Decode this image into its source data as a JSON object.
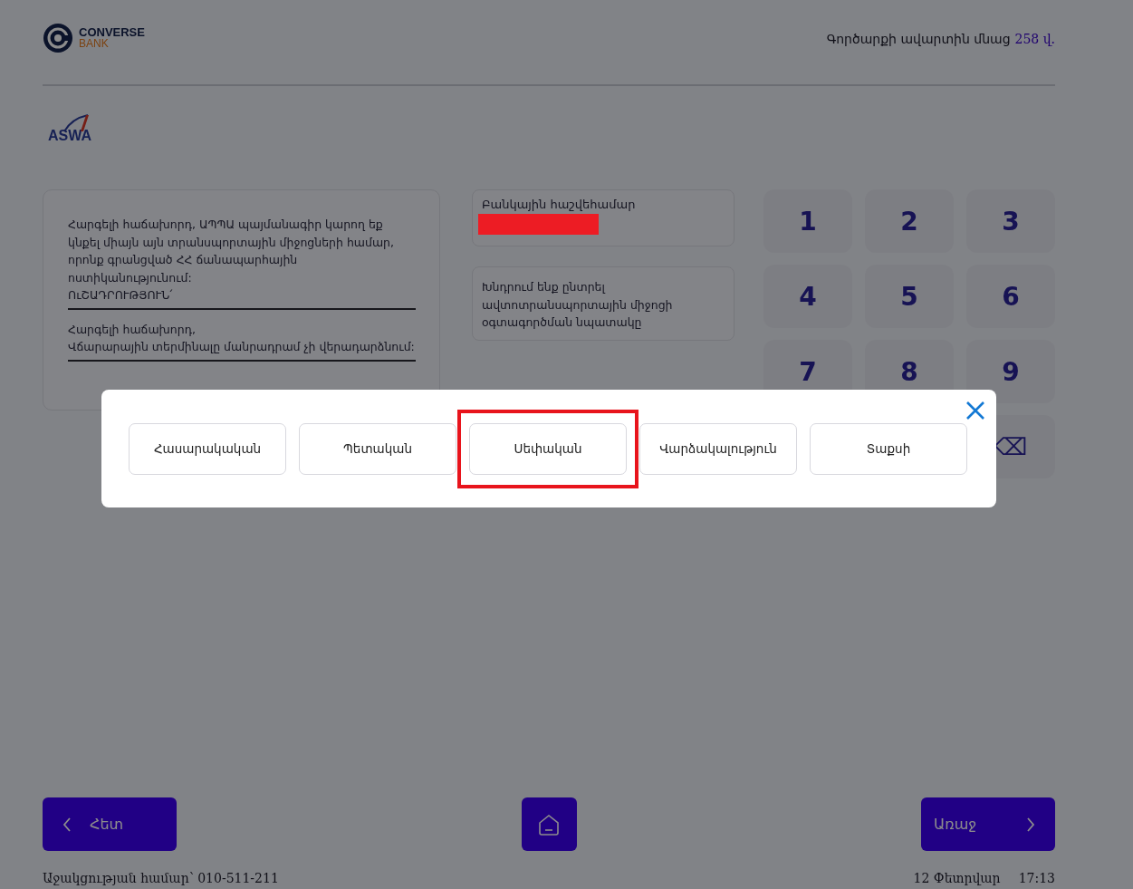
{
  "header": {
    "logo": {
      "name": "CONVERSE",
      "sub": "BANK"
    },
    "timer": {
      "label": "Գործարքի ավարտին մնաց",
      "value": "258 վ."
    }
  },
  "partner_logo": {
    "text": "ASWA"
  },
  "notice": {
    "paragraphs": [
      {
        "lines": [
          "Հարգելի հաճախորդ, ԱՊՊԱ պայմանագիր կարող եք կնքել միայն այն տրանսպորտային միջոցների համար, որոնք գրանցված ՀՀ ճանապարհային ոստիկանությունում:",
          "ՈւՇԱԴՐՈՒԹՅՈՒՆ՛"
        ]
      },
      {
        "lines": [
          "Հարգելի հաճախորդ,",
          "Վճարարային տերմինալը մանրադրամ չի վերադարձնում:"
        ]
      }
    ]
  },
  "account": {
    "label": "Բանկային հաշվեհամար",
    "redacted": true
  },
  "prompt": "Խնդրում ենք ընտրել ավտոտրանսպորտային միջոցի օգտագործման նպատակը",
  "keypad": [
    {
      "kind": "digit",
      "label": "1"
    },
    {
      "kind": "digit",
      "label": "2"
    },
    {
      "kind": "digit",
      "label": "3"
    },
    {
      "kind": "digit",
      "label": "4"
    },
    {
      "kind": "digit",
      "label": "5"
    },
    {
      "kind": "digit",
      "label": "6"
    },
    {
      "kind": "digit",
      "label": "7"
    },
    {
      "kind": "digit",
      "label": "8"
    },
    {
      "kind": "digit",
      "label": "9"
    },
    {
      "kind": "backspace",
      "label": "⌫"
    }
  ],
  "modal": {
    "options": [
      {
        "label": "Հասարակական",
        "selected": false
      },
      {
        "label": "Պետական",
        "selected": false
      },
      {
        "label": "Սեփական",
        "selected": true
      },
      {
        "label": "Վարձակալություն",
        "selected": false
      },
      {
        "label": "Տաքսի",
        "selected": false
      }
    ]
  },
  "footer": {
    "back": "Հետ",
    "next": "Առաջ",
    "help": "Աջակցության համար՝  010-511-211",
    "date": "12 Փետրվար",
    "time": "17:13"
  }
}
